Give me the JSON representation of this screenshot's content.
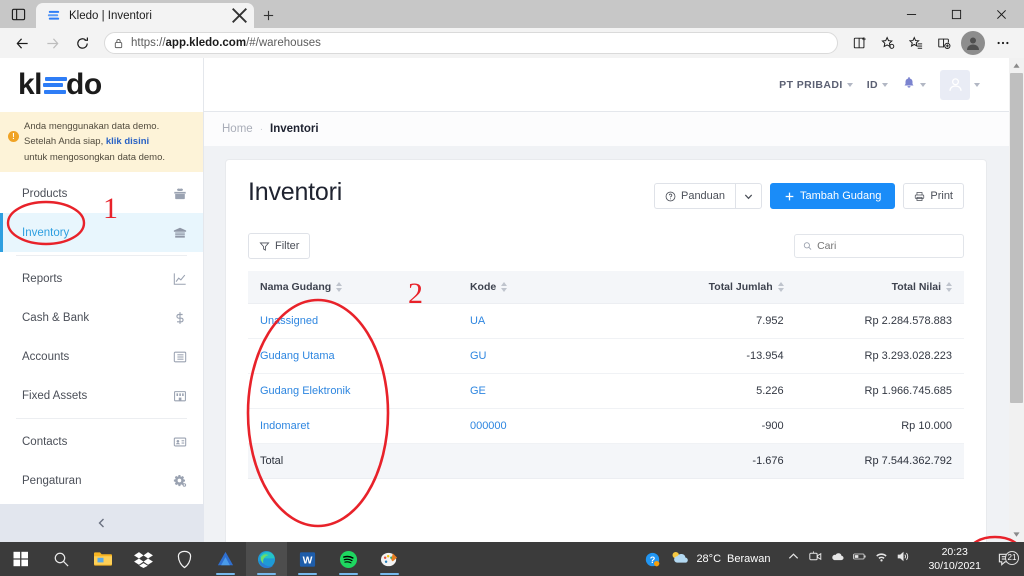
{
  "browser": {
    "tab_title": "Kledo | Inventori",
    "new_tab_label": "+",
    "url_prefix": "https://",
    "url_bold": "app.kledo.com",
    "url_suffix": "/#/warehouses",
    "icons": {
      "tab_strip": "tab-strip-icon",
      "favicon": "kledo-favicon",
      "close_tab": "close-tab-icon",
      "back": "back-arrow-icon",
      "forward": "forward-arrow-icon",
      "reload": "reload-icon",
      "lock": "lock-icon",
      "split_screen": "split-screen-icon",
      "favorite": "add-favorite-icon",
      "favorites_bar": "favorites-list-icon",
      "collections": "collections-icon",
      "profile": "profile-avatar-icon",
      "settings_more": "more-options-icon",
      "minimize": "minimize-icon",
      "maximize": "maximize-icon",
      "close_window": "close-window-icon"
    }
  },
  "sidebar": {
    "logo": {
      "part1": "kl",
      "part2": "do"
    },
    "demo_banner": {
      "line1": "Anda menggunakan data demo.",
      "line2_pre": "Setelah Anda siap, ",
      "link": "klik disini",
      "line3": "untuk mengosongkan data demo."
    },
    "items": [
      {
        "label": "Products",
        "icon": "products-icon",
        "active": false
      },
      {
        "label": "Inventory",
        "icon": "warehouse-icon",
        "active": true
      },
      {
        "label": "Reports",
        "icon": "chart-icon",
        "active": false
      },
      {
        "label": "Cash & Bank",
        "icon": "dollar-icon",
        "active": false
      },
      {
        "label": "Accounts",
        "icon": "list-icon",
        "active": false
      },
      {
        "label": "Fixed Assets",
        "icon": "building-icon",
        "active": false
      },
      {
        "label": "Contacts",
        "icon": "contact-card-icon",
        "active": false
      },
      {
        "label": "Pengaturan",
        "icon": "gear-icon",
        "active": false
      }
    ],
    "collapse_icon": "chevron-left-icon"
  },
  "topbar": {
    "company": "PT PRIBADI",
    "language": "ID",
    "bell_icon": "bell-icon",
    "avatar_icon": "user-avatar-icon"
  },
  "breadcrumb": {
    "home": "Home",
    "separator": "·",
    "current": "Inventori"
  },
  "page": {
    "title": "Inventori",
    "buttons": {
      "panduan": "Panduan",
      "panduan_icon": "question-circle-icon",
      "panduan_caret_icon": "chevron-down-icon",
      "tambah_gudang": "Tambah Gudang",
      "tambah_icon": "plus-icon",
      "print": "Print",
      "print_icon": "printer-icon"
    },
    "filter_label": "Filter",
    "filter_icon": "funnel-icon",
    "search": {
      "placeholder": "Cari",
      "value": "",
      "icon": "search-icon"
    }
  },
  "table": {
    "columns": [
      {
        "label": "Nama Gudang",
        "align": "left"
      },
      {
        "label": "Kode",
        "align": "left"
      },
      {
        "label": "Total Jumlah",
        "align": "right"
      },
      {
        "label": "Total Nilai",
        "align": "right"
      }
    ],
    "rows": [
      {
        "name": "Unassigned",
        "code": "UA",
        "qty": "7.952",
        "value": "Rp 2.284.578.883"
      },
      {
        "name": "Gudang Utama",
        "code": "GU",
        "qty": "-13.954",
        "value": "Rp 3.293.028.223"
      },
      {
        "name": "Gudang Elektronik",
        "code": "GE",
        "qty": "5.226",
        "value": "Rp 1.966.745.685"
      },
      {
        "name": "Indomaret",
        "code": "000000",
        "qty": "-900",
        "value": "Rp 10.000"
      }
    ],
    "total": {
      "label": "Total",
      "code": "",
      "qty": "-1.676",
      "value": "Rp 7.544.362.792"
    }
  },
  "annotations": [
    {
      "id": "1",
      "target": "sidebar-item-inventory"
    },
    {
      "id": "2",
      "target": "nama-gudang-column"
    }
  ],
  "taskbar": {
    "items": [
      {
        "icon": "windows-start-icon",
        "state": "idle"
      },
      {
        "icon": "search-icon",
        "state": "idle"
      },
      {
        "icon": "file-explorer-icon",
        "state": "idle"
      },
      {
        "icon": "dropbox-icon",
        "state": "idle"
      },
      {
        "icon": "brave-icon",
        "state": "idle"
      },
      {
        "icon": "app-blue-icon",
        "state": "running"
      },
      {
        "icon": "edge-icon",
        "state": "active"
      },
      {
        "icon": "word-icon",
        "state": "running"
      },
      {
        "icon": "spotify-icon",
        "state": "running"
      },
      {
        "icon": "paint-icon",
        "state": "running"
      }
    ],
    "help_icon": "help-circle-icon",
    "weather": {
      "temp": "28°C",
      "condition": "Berawan",
      "icon": "partly-cloudy-icon"
    },
    "tray_icons": [
      "chevron-up-icon",
      "meet-now-icon",
      "onedrive-icon",
      "battery-icon",
      "wifi-icon",
      "volume-icon"
    ],
    "clock": {
      "time": "20:23",
      "date": "30/10/2021"
    },
    "notification": {
      "icon": "notification-icon",
      "count": "21"
    }
  },
  "colors": {
    "accent_blue": "#1a8cf8",
    "link_blue": "#2e86e0",
    "active_nav": "#2e9fe0",
    "annotation_red": "#e8222a",
    "banner_yellow": "#fdf3d8"
  }
}
